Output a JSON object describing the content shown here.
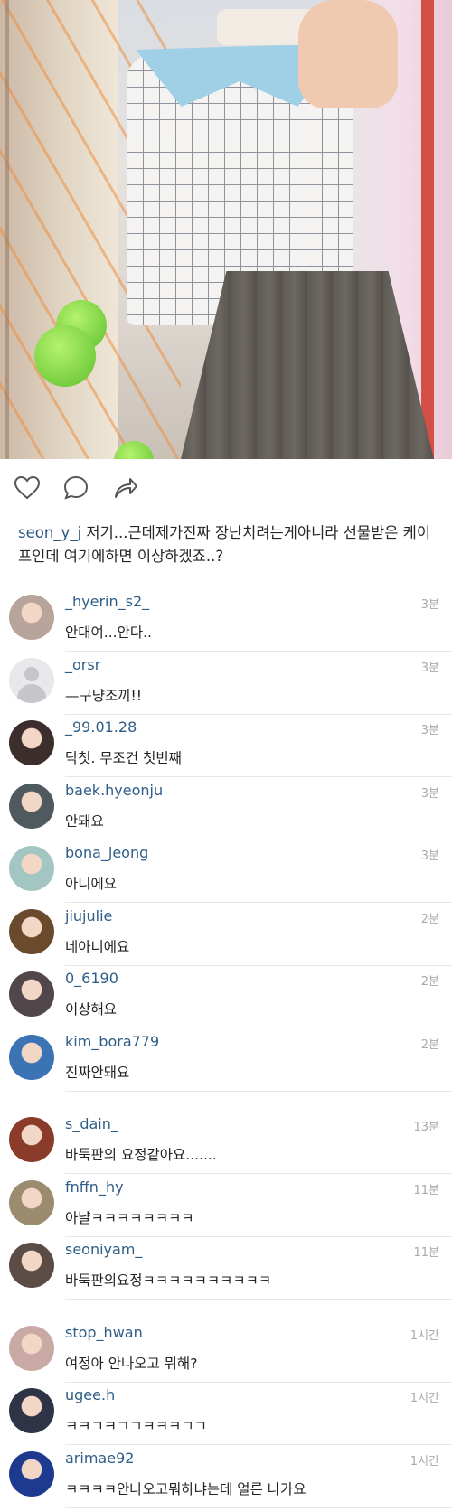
{
  "post": {
    "caption_user": "seon_y_j",
    "caption_text": "저기...근데제가진짜 장난치려는게아니라 선물받은 케이프인데 여기에하면 이상하겠죠..?"
  },
  "icons": {
    "like": "heart-icon",
    "comment": "comment-bubble-icon",
    "share": "share-arrow-icon"
  },
  "colors": {
    "username": "#2e5d88",
    "timestamp": "#aaaaaa"
  },
  "comments": [
    {
      "user": "_hyerin_s2_",
      "text": "안대여...안다..",
      "time": "3분",
      "avatar_color": "#b8a49a"
    },
    {
      "user": "_orsr",
      "text": "—구냥조끼!!",
      "time": "3분",
      "avatar_color": "default"
    },
    {
      "user": "_99.01.28",
      "text": "닥첫. 무조건 첫번째",
      "time": "3분",
      "avatar_color": "#3b2e2d"
    },
    {
      "user": "baek.hyeonju",
      "text": "안돼요",
      "time": "3분",
      "avatar_color": "#4f5a5e"
    },
    {
      "user": "bona_jeong",
      "text": "아니에요",
      "time": "3분",
      "avatar_color": "#a4c6c2"
    },
    {
      "user": "jiujulie",
      "text": "네아니에요",
      "time": "2분",
      "avatar_color": "#6a4a2d"
    },
    {
      "user": "0_6190",
      "text": "이상해요",
      "time": "2분",
      "avatar_color": "#51464a"
    },
    {
      "user": "kim_bora779",
      "text": "진짜안돼요",
      "time": "2분",
      "avatar_color": "#3b73b5"
    },
    {
      "user": "s_dain_",
      "text": "바둑판의 요정같아요.......",
      "time": "13분",
      "avatar_color": "#8a3b2a"
    },
    {
      "user": "fnffn_hy",
      "text": "아냘ㅋㅋㅋㅋㅋㅋㅋㅋ",
      "time": "11분",
      "avatar_color": "#9c8c6f"
    },
    {
      "user": "seoniyam_",
      "text": "바둑판의요정ㅋㅋㅋㅋㅋㅋㅋㅋㅋㅋ",
      "time": "11분",
      "avatar_color": "#5b4d45"
    },
    {
      "user": "stop_hwan",
      "text": "여정아 안나오고 뭐해?",
      "time": "1시간",
      "avatar_color": "#c9a9a4"
    },
    {
      "user": "ugee.h",
      "text": "ㅋㅋㄱㅋㄱㄱㅋㅋㅋㄱㄱ",
      "time": "1시간",
      "avatar_color": "#2f3346"
    },
    {
      "user": "arimae92",
      "text": "ㅋㅋㅋㅋ안나오고뭐하냐는데 얼른 나가요",
      "time": "1시간",
      "avatar_color": "#1e3a8f"
    }
  ]
}
